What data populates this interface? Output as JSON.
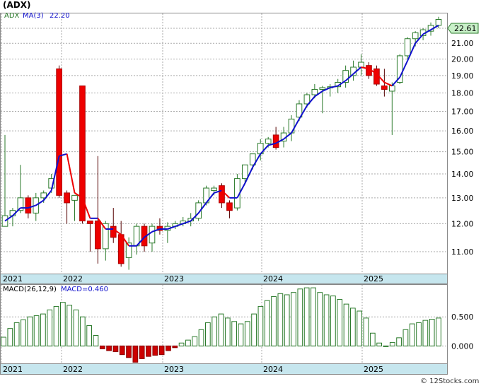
{
  "chart_data": [
    {
      "type": "candlestick",
      "title": "(ADX)",
      "legend": [
        {
          "label": "ADX",
          "color": "#2a7a2a"
        },
        {
          "label": "MA(3)",
          "color": "#1010cc"
        },
        {
          "label": "22.20",
          "color": "#1010cc"
        }
      ],
      "last_price_label": "22.61",
      "y_ticks": [
        "22.00",
        "21.00",
        "20.00",
        "19.00",
        "18.00",
        "17.00",
        "16.00",
        "15.00",
        "14.00",
        "13.00",
        "12.00",
        "11.00"
      ],
      "x_ticks": [
        "2021",
        "2022",
        "2023",
        "2024",
        "2025"
      ],
      "log_scale": true,
      "grid": true,
      "candles": [
        {
          "o": 11.9,
          "h": 15.8,
          "l": 11.9,
          "c": 12.3,
          "d": "up"
        },
        {
          "o": 12.3,
          "h": 12.6,
          "l": 11.9,
          "c": 12.5,
          "d": "up"
        },
        {
          "o": 12.5,
          "h": 14.4,
          "l": 12.4,
          "c": 13.0,
          "d": "up"
        },
        {
          "o": 13.0,
          "h": 13.1,
          "l": 12.2,
          "c": 12.4,
          "d": "down"
        },
        {
          "o": 12.4,
          "h": 13.2,
          "l": 12.1,
          "c": 13.0,
          "d": "up"
        },
        {
          "o": 13.0,
          "h": 13.3,
          "l": 12.8,
          "c": 13.2,
          "d": "up"
        },
        {
          "o": 13.4,
          "h": 14.0,
          "l": 13.2,
          "c": 13.8,
          "d": "up"
        },
        {
          "o": 19.4,
          "h": 19.6,
          "l": 13.0,
          "c": 13.1,
          "d": "down"
        },
        {
          "o": 13.2,
          "h": 13.3,
          "l": 12.0,
          "c": 12.8,
          "d": "down"
        },
        {
          "o": 12.9,
          "h": 13.1,
          "l": 12.1,
          "c": 13.1,
          "d": "up"
        },
        {
          "o": 18.4,
          "h": 18.4,
          "l": 12.0,
          "c": 12.1,
          "d": "down"
        },
        {
          "o": 12.1,
          "h": 12.1,
          "l": 11.0,
          "c": 12.0,
          "d": "down"
        },
        {
          "o": 12.1,
          "h": 14.8,
          "l": 10.6,
          "c": 11.1,
          "d": "down"
        },
        {
          "o": 11.1,
          "h": 12.1,
          "l": 10.7,
          "c": 12.0,
          "d": "up"
        },
        {
          "o": 11.9,
          "h": 12.6,
          "l": 11.3,
          "c": 11.5,
          "d": "down"
        },
        {
          "o": 11.6,
          "h": 12.1,
          "l": 10.5,
          "c": 10.6,
          "d": "down"
        },
        {
          "o": 10.8,
          "h": 11.5,
          "l": 10.4,
          "c": 11.3,
          "d": "up"
        },
        {
          "o": 11.2,
          "h": 12.0,
          "l": 10.9,
          "c": 11.9,
          "d": "up"
        },
        {
          "o": 11.9,
          "h": 12.0,
          "l": 11.0,
          "c": 11.2,
          "d": "down"
        },
        {
          "o": 11.3,
          "h": 12.0,
          "l": 11.0,
          "c": 11.9,
          "d": "up"
        },
        {
          "o": 11.9,
          "h": 12.2,
          "l": 11.6,
          "c": 11.75,
          "d": "down"
        },
        {
          "o": 11.75,
          "h": 12.05,
          "l": 11.3,
          "c": 11.9,
          "d": "up"
        },
        {
          "o": 11.9,
          "h": 12.1,
          "l": 11.8,
          "c": 12.0,
          "d": "up"
        },
        {
          "o": 12.0,
          "h": 12.25,
          "l": 11.9,
          "c": 12.1,
          "d": "up"
        },
        {
          "o": 12.1,
          "h": 12.4,
          "l": 11.9,
          "c": 12.2,
          "d": "up"
        },
        {
          "o": 12.2,
          "h": 12.9,
          "l": 12.1,
          "c": 12.8,
          "d": "up"
        },
        {
          "o": 12.8,
          "h": 13.5,
          "l": 12.7,
          "c": 13.4,
          "d": "up"
        },
        {
          "o": 13.4,
          "h": 13.5,
          "l": 13.1,
          "c": 13.3,
          "d": "up"
        },
        {
          "o": 13.5,
          "h": 13.6,
          "l": 12.6,
          "c": 12.8,
          "d": "down"
        },
        {
          "o": 12.8,
          "h": 12.9,
          "l": 12.2,
          "c": 12.5,
          "d": "down"
        },
        {
          "o": 12.6,
          "h": 14.0,
          "l": 12.5,
          "c": 13.8,
          "d": "up"
        },
        {
          "o": 13.8,
          "h": 14.4,
          "l": 13.6,
          "c": 14.4,
          "d": "up"
        },
        {
          "o": 14.4,
          "h": 14.9,
          "l": 14.2,
          "c": 14.9,
          "d": "up"
        },
        {
          "o": 14.9,
          "h": 15.6,
          "l": 14.6,
          "c": 15.4,
          "d": "up"
        },
        {
          "o": 15.4,
          "h": 15.7,
          "l": 15.2,
          "c": 15.6,
          "d": "up"
        },
        {
          "o": 15.8,
          "h": 16.2,
          "l": 15.1,
          "c": 15.2,
          "d": "down"
        },
        {
          "o": 15.5,
          "h": 16.2,
          "l": 15.2,
          "c": 15.9,
          "d": "up"
        },
        {
          "o": 15.9,
          "h": 16.8,
          "l": 15.5,
          "c": 16.6,
          "d": "up"
        },
        {
          "o": 16.7,
          "h": 17.6,
          "l": 16.5,
          "c": 17.4,
          "d": "up"
        },
        {
          "o": 17.4,
          "h": 18.0,
          "l": 17.2,
          "c": 17.9,
          "d": "up"
        },
        {
          "o": 17.9,
          "h": 18.5,
          "l": 17.7,
          "c": 18.2,
          "d": "up"
        },
        {
          "o": 18.2,
          "h": 18.4,
          "l": 16.9,
          "c": 18.3,
          "d": "up"
        },
        {
          "o": 18.3,
          "h": 18.5,
          "l": 17.8,
          "c": 18.35,
          "d": "up"
        },
        {
          "o": 18.35,
          "h": 18.8,
          "l": 18.0,
          "c": 18.6,
          "d": "up"
        },
        {
          "o": 18.6,
          "h": 19.6,
          "l": 18.3,
          "c": 19.3,
          "d": "up"
        },
        {
          "o": 19.0,
          "h": 19.9,
          "l": 18.7,
          "c": 19.5,
          "d": "up"
        },
        {
          "o": 19.5,
          "h": 20.3,
          "l": 19.0,
          "c": 19.8,
          "d": "up"
        },
        {
          "o": 19.6,
          "h": 19.8,
          "l": 18.8,
          "c": 19.0,
          "d": "down"
        },
        {
          "o": 19.4,
          "h": 19.6,
          "l": 18.4,
          "c": 18.5,
          "d": "down"
        },
        {
          "o": 18.4,
          "h": 19.4,
          "l": 17.8,
          "c": 18.2,
          "d": "down"
        },
        {
          "o": 18.1,
          "h": 18.6,
          "l": 15.8,
          "c": 18.4,
          "d": "up"
        },
        {
          "o": 18.6,
          "h": 20.3,
          "l": 18.5,
          "c": 20.2,
          "d": "up"
        },
        {
          "o": 20.2,
          "h": 21.4,
          "l": 20.0,
          "c": 21.3,
          "d": "up"
        },
        {
          "o": 21.3,
          "h": 21.8,
          "l": 20.8,
          "c": 21.7,
          "d": "up"
        },
        {
          "o": 21.5,
          "h": 22.0,
          "l": 21.2,
          "c": 21.9,
          "d": "up"
        },
        {
          "o": 21.8,
          "h": 22.4,
          "l": 21.5,
          "c": 22.2,
          "d": "up"
        },
        {
          "o": 22.2,
          "h": 22.8,
          "l": 22.0,
          "c": 22.61,
          "d": "up"
        }
      ],
      "ma3": [
        12.1,
        12.3,
        12.6,
        12.6,
        12.7,
        12.9,
        13.3,
        14.8,
        14.9,
        13.2,
        13.0,
        12.2,
        12.2,
        11.8,
        11.8,
        11.6,
        11.2,
        11.2,
        11.5,
        11.7,
        11.8,
        11.8,
        11.9,
        12.0,
        12.1,
        12.4,
        12.8,
        13.2,
        13.3,
        13.0,
        13.0,
        13.6,
        14.3,
        14.9,
        15.3,
        15.4,
        15.6,
        15.9,
        16.6,
        17.3,
        17.8,
        18.1,
        18.3,
        18.4,
        18.7,
        19.1,
        19.5,
        19.4,
        19.1,
        18.6,
        18.4,
        18.9,
        19.9,
        21.0,
        21.6,
        21.9,
        22.2
      ]
    },
    {
      "type": "bar",
      "title": "MACD(26,12,9)",
      "legend": [
        {
          "label": "MACD(26,12,9)",
          "color": "#000000"
        },
        {
          "label": "MACD=0.460",
          "color": "#1010cc"
        }
      ],
      "y_ticks": [
        "0.500",
        "0.000"
      ],
      "x_ticks": [
        "2021",
        "2022",
        "2023",
        "2024",
        "2025"
      ],
      "ylim": [
        -0.3,
        1.05
      ],
      "values": [
        0.15,
        0.3,
        0.4,
        0.45,
        0.5,
        0.52,
        0.55,
        0.62,
        0.68,
        0.75,
        0.7,
        0.62,
        0.5,
        0.35,
        0.18,
        -0.05,
        -0.08,
        -0.1,
        -0.15,
        -0.2,
        -0.28,
        -0.22,
        -0.18,
        -0.16,
        -0.15,
        -0.08,
        -0.03,
        0.05,
        0.1,
        0.16,
        0.28,
        0.4,
        0.5,
        0.55,
        0.48,
        0.42,
        0.38,
        0.42,
        0.55,
        0.68,
        0.78,
        0.85,
        0.9,
        0.88,
        0.92,
        0.98,
        1.0,
        1.0,
        0.92,
        0.88,
        0.86,
        0.8,
        0.72,
        0.65,
        0.6,
        0.48,
        0.22,
        0.05,
        0.0,
        0.06,
        0.14,
        0.28,
        0.38,
        0.4,
        0.44,
        0.46,
        0.48
      ]
    }
  ],
  "watermark": "© 12Stocks.com"
}
